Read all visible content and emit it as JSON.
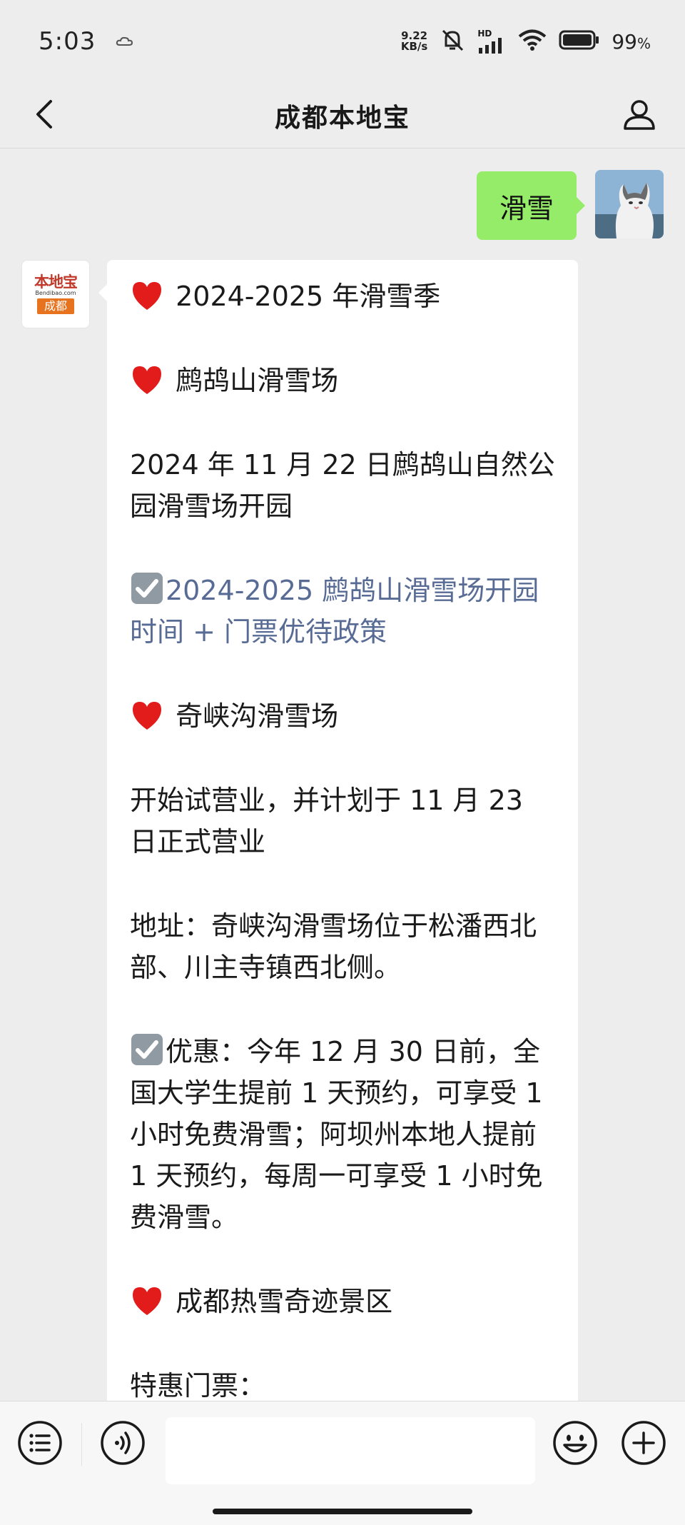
{
  "status_bar": {
    "time": "5:03",
    "net_speed_value": "9.22",
    "net_speed_unit": "KB/s",
    "network": "HD",
    "battery": "99",
    "battery_unit": "%"
  },
  "header": {
    "title": "成都本地宝"
  },
  "outgoing": {
    "text": "滑雪"
  },
  "bot": {
    "logo_main": "本地宝",
    "logo_sub": "Bendibao.com",
    "logo_city": "成都"
  },
  "message": {
    "p1": "2024-2025 年滑雪季",
    "p2": "鹧鸪山滑雪场",
    "p3": "2024 年 11 月 22 日鹧鸪山自然公园滑雪场开园",
    "p4_link": "2024-2025 鹧鸪山滑雪场开园时间 + 门票优待政策",
    "p5": "奇峡沟滑雪场",
    "p6": "开始试营业，并计划于 11 月 23 日正式营业",
    "p7": "地址：奇峡沟滑雪场位于松潘西北部、川主寺镇西北侧。",
    "p8": "优惠：今年 12 月 30 日前，全国大学生提前 1 天预约，可享受 1 小时免费滑雪；阿坝州本地人提前 1 天预约，每周一可享受 1 小时免费滑雪。",
    "p9": "成都热雪奇迹景区",
    "p10": "特惠门票："
  },
  "icons": {
    "back": "chevron-left-icon",
    "profile": "person-icon",
    "menu": "list-icon",
    "voice": "voice-icon",
    "emoji": "emoji-icon",
    "plus": "plus-icon",
    "heart": "red-heart-icon",
    "check": "check-box-icon"
  },
  "colors": {
    "outgoing_bubble": "#95ec69",
    "link": "#576b95",
    "background": "#ededed"
  }
}
